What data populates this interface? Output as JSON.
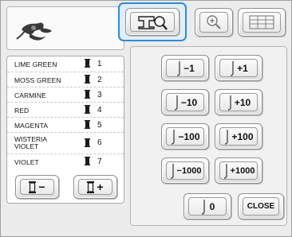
{
  "colors": {
    "accent": "#2f8bd9",
    "spool": "#1a1a1a"
  },
  "thread_list": [
    {
      "name": "LIME GREEN",
      "number": "1"
    },
    {
      "name": "MOSS GREEN",
      "number": "2"
    },
    {
      "name": "CARMINE",
      "number": "3"
    },
    {
      "name": "RED",
      "number": "4"
    },
    {
      "name": "MAGENTA",
      "number": "5"
    },
    {
      "name_line1": "WISTERIA",
      "name_line2": "VIOLET",
      "number": "6"
    },
    {
      "name": "VIOLET",
      "number": "7"
    }
  ],
  "bottom_left": {
    "remove_label": "−",
    "add_label": "+"
  },
  "tabs": {
    "search_icon": "magnifier-sewing-machine-icon",
    "zoom_icon": "zoom-in-icon",
    "grid_icon": "grid-icon"
  },
  "move_buttons": {
    "minus_1": "−1",
    "plus_1": "+1",
    "minus_10": "−10",
    "plus_10": "+10",
    "minus_100": "−100",
    "plus_100": "+100",
    "minus_1000": "−1000",
    "plus_1000": "+1000"
  },
  "needle_counter": {
    "value": "0"
  },
  "close_label": "CLOSE"
}
